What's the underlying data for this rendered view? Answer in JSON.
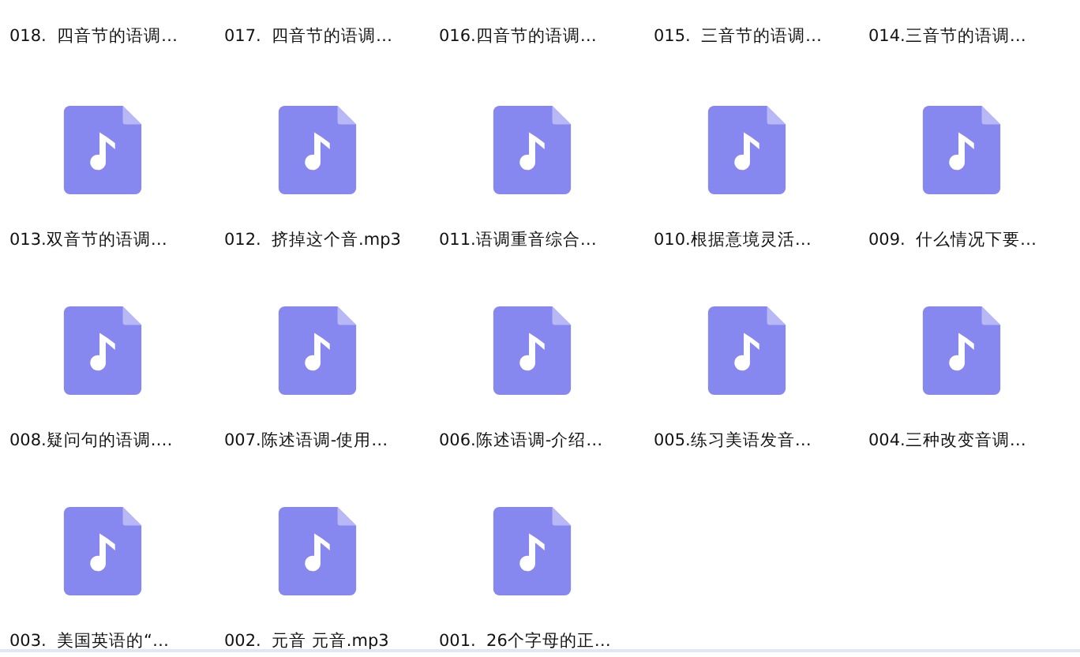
{
  "files": [
    {
      "name": "018.  四音节的语调…",
      "kind": "label_only"
    },
    {
      "name": "017.  四音节的语调…",
      "kind": "label_only"
    },
    {
      "name": "016.四音节的语调…",
      "kind": "label_only"
    },
    {
      "name": "015.  三音节的语调…",
      "kind": "label_only"
    },
    {
      "name": "014.三音节的语调…",
      "kind": "label_only"
    },
    {
      "name": "013.双音节的语调…",
      "kind": "audio"
    },
    {
      "name": "012.  挤掉这个音.mp3",
      "kind": "audio"
    },
    {
      "name": "011.语调重音综合…",
      "kind": "audio"
    },
    {
      "name": "010.根据意境灵活…",
      "kind": "audio"
    },
    {
      "name": "009.  什么情况下要…",
      "kind": "audio"
    },
    {
      "name": "008.疑问句的语调.…",
      "kind": "audio"
    },
    {
      "name": "007.陈述语调-使用…",
      "kind": "audio"
    },
    {
      "name": "006.陈述语调-介绍…",
      "kind": "audio"
    },
    {
      "name": "005.练习美语发音…",
      "kind": "audio"
    },
    {
      "name": "004.三种改变音调…",
      "kind": "audio"
    },
    {
      "name": "003.  美国英语的“…",
      "kind": "audio"
    },
    {
      "name": "002.  元音 元音.mp3",
      "kind": "audio"
    },
    {
      "name": "001.  26个字母的正…",
      "kind": "audio"
    }
  ]
}
